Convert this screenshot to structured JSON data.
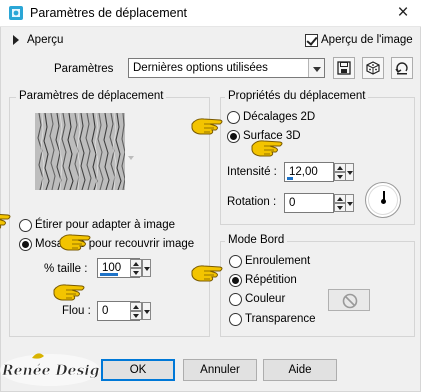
{
  "window": {
    "title": "Paramètres de déplacement"
  },
  "top": {
    "preview_toggle_label": "Aperçu",
    "preview_image_label": "Aperçu de l'image",
    "preview_image_checked": true,
    "presets_label": "Paramètres",
    "presets_value": "Dernières options utilisées"
  },
  "displacement_settings": {
    "legend": "Paramètres de déplacement",
    "options": [
      {
        "label": "Étirer pour adapter à image",
        "checked": false
      },
      {
        "label": "Mosaïque pour recouvrir image",
        "checked": true
      }
    ],
    "size_label": "% taille :",
    "size_value": "100",
    "blur_label": "Flou :",
    "blur_value": "0"
  },
  "displacement_props": {
    "legend": "Propriétés du déplacement",
    "options": [
      {
        "label": "Décalages 2D",
        "checked": false
      },
      {
        "label": "Surface 3D",
        "checked": true
      }
    ],
    "intensity_label": "Intensité :",
    "intensity_value": "12,00",
    "rotation_label": "Rotation :",
    "rotation_value": "0"
  },
  "edge_mode": {
    "legend": "Mode Bord",
    "options": [
      {
        "label": "Enroulement",
        "checked": false
      },
      {
        "label": "Répétition",
        "checked": true
      },
      {
        "label": "Couleur",
        "checked": false
      },
      {
        "label": "Transparence",
        "checked": false
      }
    ]
  },
  "buttons": {
    "ok": "OK",
    "cancel": "Annuler",
    "help": "Aide"
  },
  "watermark": "Renée Design",
  "colors": {
    "accent": "#1e73c8",
    "dialog_bg": "#f0f0f0",
    "hand_yellow": "#f3c400"
  }
}
